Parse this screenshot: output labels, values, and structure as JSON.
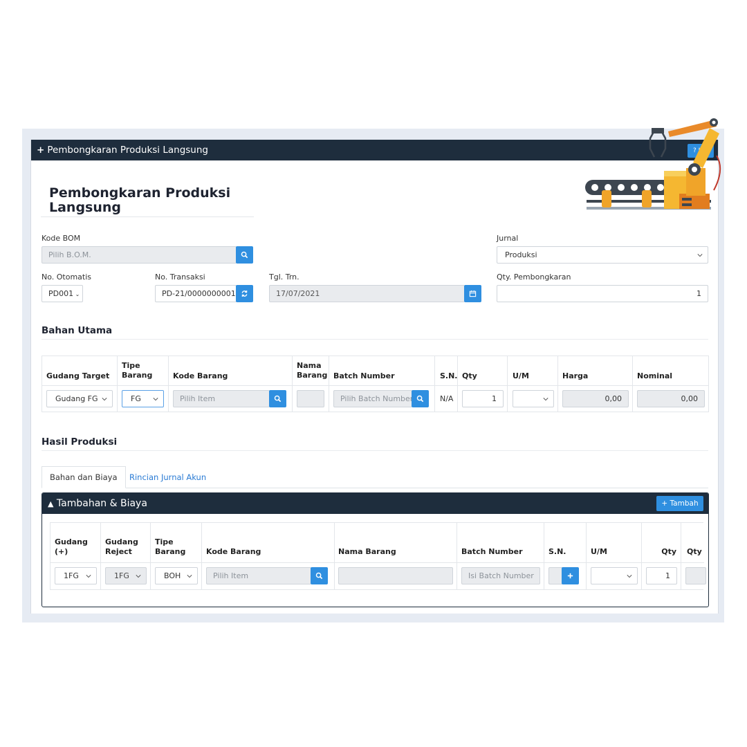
{
  "window": {
    "title": "Pembongkaran Produksi Langsung",
    "help_label": "? H"
  },
  "page": {
    "title_line1": "Pembongkaran Produksi",
    "title_line2": "Langsung"
  },
  "form": {
    "kode_bom_label": "Kode BOM",
    "kode_bom_placeholder": "Pilih B.O.M.",
    "jurnal_label": "Jurnal",
    "jurnal_value": "Produksi",
    "no_otomatis_label": "No. Otomatis",
    "no_otomatis_value": "PD001",
    "no_transaksi_label": "No. Transaksi",
    "no_transaksi_value": "PD-21/0000000001",
    "tgl_label": "Tgl. Trn.",
    "tgl_value": "17/07/2021",
    "qty_label": "Qty. Pembongkaran",
    "qty_value": "1"
  },
  "bahan_utama": {
    "title": "Bahan Utama",
    "headers": {
      "gudang_target": "Gudang Target",
      "tipe_barang": "Tipe Barang",
      "kode_barang": "Kode Barang",
      "nama_barang": "Nama Barang",
      "batch_number": "Batch Number",
      "sn": "S.N.",
      "qty": "Qty",
      "um": "U/M",
      "harga": "Harga",
      "nominal": "Nominal"
    },
    "row": {
      "gudang": "Gudang FG",
      "tipe": "FG",
      "kode_placeholder": "Pilih Item",
      "batch_placeholder": "Pilih Batch Number",
      "sn": "N/A",
      "qty": "1",
      "harga": "0,00",
      "nominal": "0,00"
    }
  },
  "hasil_produksi": {
    "title": "Hasil Produksi",
    "tabs": [
      "Bahan dan Biaya",
      "Rincian Jurnal Akun"
    ],
    "panel_title": "Tambahan & Biaya",
    "add_label": "+ Tambah",
    "headers": {
      "gudang_plus_1": "Gudang",
      "gudang_plus_2": "(+)",
      "gudang_reject_1": "Gudang",
      "gudang_reject_2": "Reject",
      "tipe_1": "Tipe",
      "tipe_2": "Barang",
      "kode_barang": "Kode Barang",
      "nama_barang": "Nama Barang",
      "batch_number": "Batch Number",
      "sn": "S.N.",
      "um": "U/M",
      "qty": "Qty",
      "qty2": "Qty"
    },
    "row": {
      "gudang_plus": "1FG",
      "gudang_reject": "1FG",
      "tipe": "BOH",
      "kode_placeholder": "Pilih Item",
      "batch_placeholder": "Isi Batch Number",
      "qty": "1"
    }
  },
  "colors": {
    "header_bg": "#1e2d3d",
    "accent": "#2f8fe0",
    "link": "#2a7bd4"
  },
  "icons": [
    "search-icon",
    "refresh-icon",
    "calendar-icon",
    "chevron-down-icon",
    "plus-icon",
    "robot-arm-illustration"
  ]
}
